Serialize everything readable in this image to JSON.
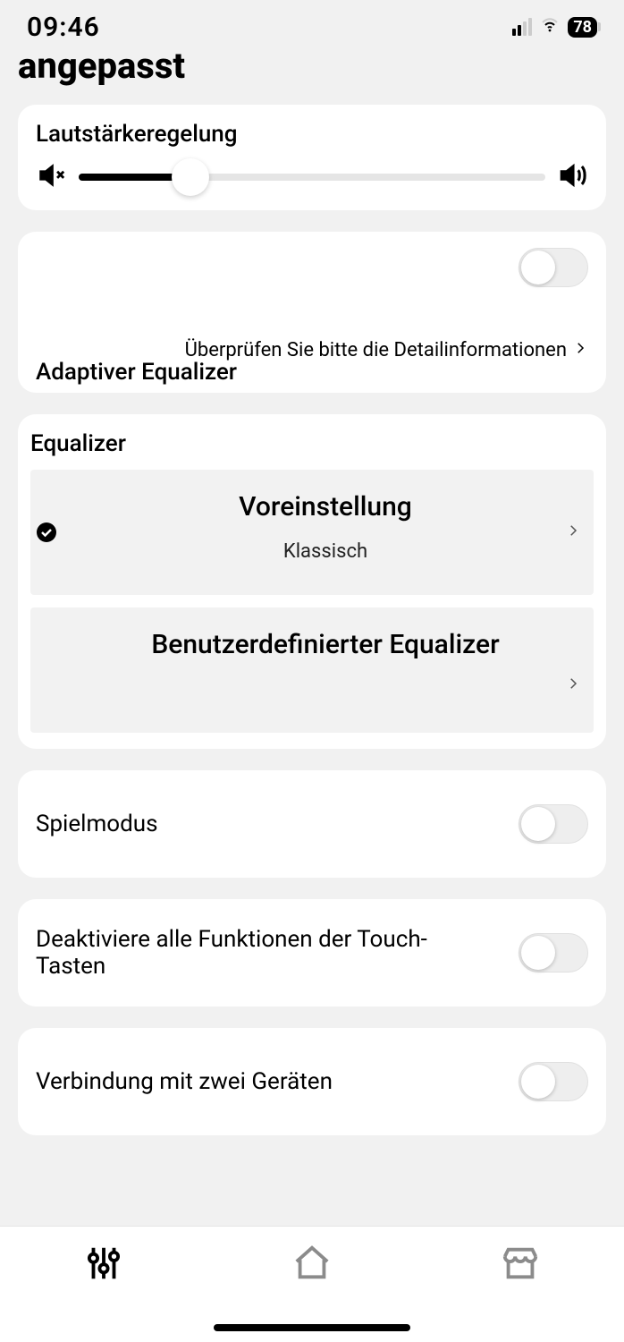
{
  "status": {
    "time": "09:46",
    "battery": "78"
  },
  "title": "angepasst",
  "volume": {
    "label": "Lautstärkeregelung",
    "percent": 24
  },
  "adaptive": {
    "detail_link": "Überprüfen Sie bitte die Detailinformationen",
    "title": "Adaptiver Equalizer",
    "enabled": false
  },
  "equalizer": {
    "section": "Equalizer",
    "preset": {
      "title": "Voreinstellung",
      "value": "Klassisch",
      "selected": true
    },
    "custom": {
      "title": "Benutzerdefinierter Equalizer",
      "selected": false
    }
  },
  "settings": {
    "game_mode": {
      "label": "Spielmodus",
      "enabled": false
    },
    "disable_touch": {
      "label": "Deaktiviere alle Funktionen der Touch-Tasten",
      "enabled": false
    },
    "dual_device": {
      "label": "Verbindung mit zwei Geräten",
      "enabled": false
    }
  }
}
